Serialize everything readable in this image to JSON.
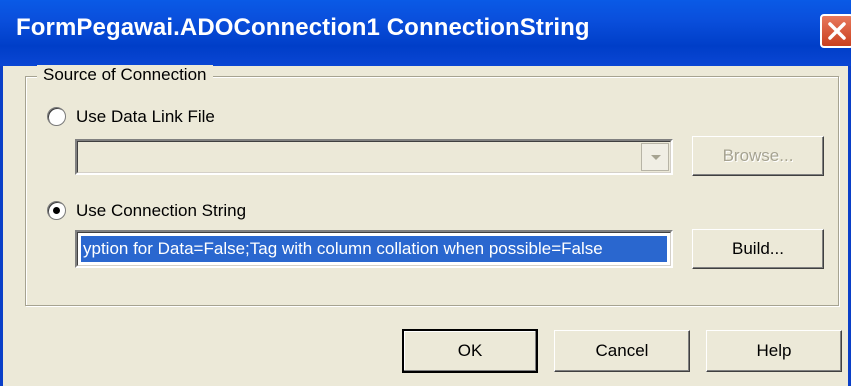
{
  "window": {
    "title": "FormPegawai.ADOConnection1 ConnectionString",
    "close_icon": "close-icon"
  },
  "group": {
    "label": "Source of Connection"
  },
  "data_link": {
    "radio_label": "Use Data Link File",
    "checked": false,
    "combo_value": "",
    "browse_label": "Browse...",
    "browse_enabled": false
  },
  "conn_string": {
    "radio_label": "Use Connection String",
    "checked": true,
    "value": "yption for Data=False;Tag with column collation when possible=False",
    "build_label": "Build..."
  },
  "buttons": {
    "ok": "OK",
    "cancel": "Cancel",
    "help": "Help"
  },
  "colors": {
    "titlebar": "#0a4fdc",
    "dialog_bg": "#ece9d8",
    "selection": "#2a67cf",
    "close": "#c9401f"
  }
}
